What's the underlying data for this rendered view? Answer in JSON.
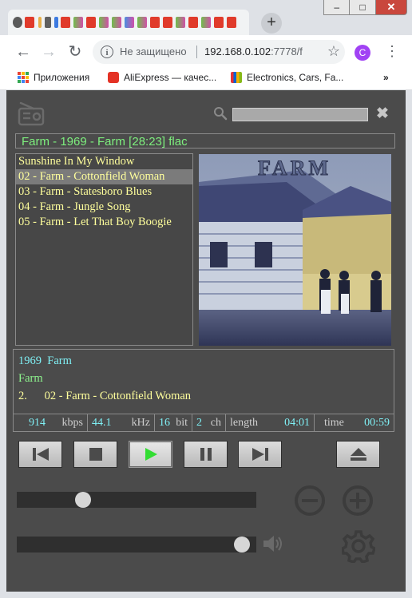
{
  "browser": {
    "new_tab": "+",
    "nav": {
      "back": "←",
      "forward": "→",
      "reload": "↻"
    },
    "omnibox": {
      "info": "i",
      "security": "Не защищено",
      "host": "192.168.0.102",
      "port": ":7778/f",
      "star": "☆"
    },
    "avatar": "C",
    "menu": "⋮",
    "bookmarks": {
      "apps": "Приложения",
      "aliexpress": "AliExpress — качес...",
      "electronics": "Electronics, Cars, Fa...",
      "more": "»"
    },
    "window": {
      "minimize": "–",
      "maximize": "□",
      "close": "✕"
    }
  },
  "player": {
    "search": {
      "placeholder": "",
      "value": ""
    },
    "clear": "✖",
    "now_playing": "Farm - 1969 - Farm [28:23] flac",
    "playlist": [
      "Sunshine In My Window",
      "02 - Farm - Cottonfield Woman",
      "03 - Farm - Statesboro Blues",
      "04 - Farm - Jungle Song",
      "05 - Farm - Let That Boy Boogie"
    ],
    "active_index": 1,
    "cover_text": "FARM",
    "info": {
      "year": "1969",
      "album": "Farm",
      "artist": "Farm",
      "track_no": "2.",
      "track_title": "02 - Farm - Cottonfield Woman"
    },
    "stats": {
      "bitrate": "914",
      "bitrate_unit": "kbps",
      "samplerate": "44.1",
      "samplerate_unit": "kHz",
      "bits": "16",
      "bits_unit": "bit",
      "channels": "2",
      "channels_unit": "ch",
      "length_label": "length",
      "length": "04:01",
      "time_label": "time",
      "time": "00:59"
    },
    "progress_fraction": 0.26,
    "volume_fraction": 0.97,
    "colors": {
      "title_green": "#7ef07e",
      "track_yellow": "#ffff9c",
      "info_cyan": "#7ff0f5",
      "info_green": "#8ef58e",
      "play_green": "#33dd33"
    }
  }
}
